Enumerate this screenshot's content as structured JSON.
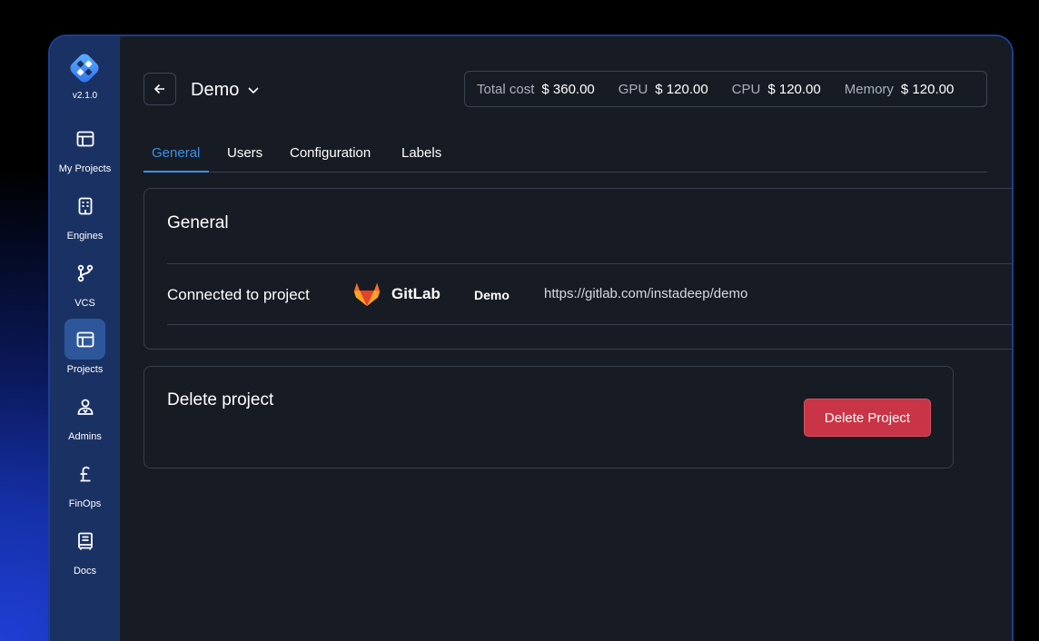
{
  "app": {
    "version": "v2.1.0",
    "logo_icon": "app-logo-icon"
  },
  "sidebar": {
    "items": [
      {
        "label": "My Projects",
        "icon": "layout-icon",
        "active": false
      },
      {
        "label": "Engines",
        "icon": "building-icon",
        "active": false
      },
      {
        "label": "VCS",
        "icon": "git-branch-icon",
        "active": false
      },
      {
        "label": "Projects",
        "icon": "layout-icon",
        "active": true
      },
      {
        "label": "Admins",
        "icon": "admin-user-icon",
        "active": false
      },
      {
        "label": "FinOps",
        "icon": "pound-icon",
        "active": false
      },
      {
        "label": "Docs",
        "icon": "book-icon",
        "active": false
      }
    ]
  },
  "header": {
    "back_icon": "arrow-left-icon",
    "project_name": "Demo",
    "dropdown_icon": "chevron-down-icon",
    "costs": {
      "total_label": "Total cost",
      "total_value": "$ 360.00",
      "gpu_label": "GPU",
      "gpu_value": "$ 120.00",
      "cpu_label": "CPU",
      "cpu_value": "$ 120.00",
      "memory_label": "Memory",
      "memory_value": "$ 120.00"
    }
  },
  "tabs": [
    {
      "label": "General",
      "active": true
    },
    {
      "label": "Users",
      "active": false
    },
    {
      "label": "Configuration",
      "active": false
    },
    {
      "label": "Labels",
      "active": false
    }
  ],
  "general_card": {
    "title": "General",
    "connected_label": "Connected to project",
    "provider": "GitLab",
    "repo_name": "Demo",
    "repo_url": "https://gitlab.com/instadeep/demo"
  },
  "delete_card": {
    "title": "Delete project",
    "button_label": "Delete Project"
  },
  "colors": {
    "accent": "#3d8fe8",
    "danger": "#c93546",
    "sidebar": "#1a3263",
    "background": "#171c24"
  }
}
